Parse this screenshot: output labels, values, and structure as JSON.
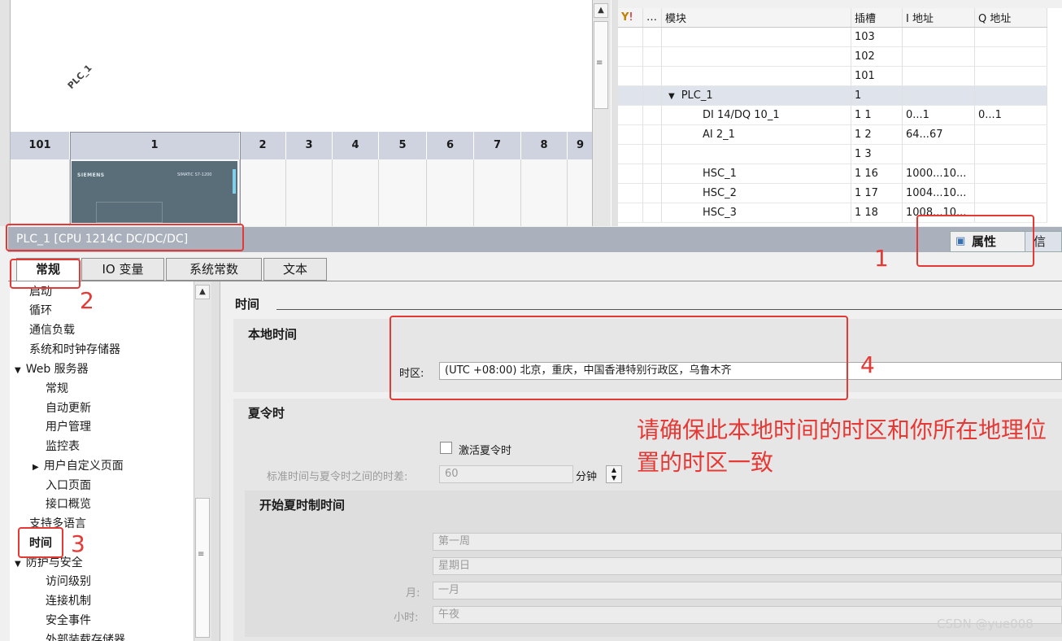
{
  "device_view": {
    "plc_label": "PLC_1",
    "slots": [
      "101",
      "1",
      "2",
      "3",
      "4",
      "5",
      "6",
      "7",
      "8",
      "9"
    ],
    "siemens_text": "SIEMENS",
    "simatic_text": "SIMATIC S7-1200"
  },
  "module_table": {
    "headers": [
      "模块",
      "插槽",
      "I 地址",
      "Q 地址"
    ],
    "rows": [
      {
        "module": "",
        "slot": "103",
        "i": "",
        "q": ""
      },
      {
        "module": "",
        "slot": "102",
        "i": "",
        "q": ""
      },
      {
        "module": "",
        "slot": "101",
        "i": "",
        "q": ""
      },
      {
        "module": "PLC_1",
        "slot": "1",
        "i": "",
        "q": ""
      },
      {
        "module": "DI 14/DQ 10_1",
        "slot": "1 1",
        "i": "0...1",
        "q": "0...1"
      },
      {
        "module": "AI 2_1",
        "slot": "1 2",
        "i": "64...67",
        "q": ""
      },
      {
        "module": "",
        "slot": "1 3",
        "i": "",
        "q": ""
      },
      {
        "module": "HSC_1",
        "slot": "1 16",
        "i": "1000...10...",
        "q": ""
      },
      {
        "module": "HSC_2",
        "slot": "1 17",
        "i": "1004...10...",
        "q": ""
      },
      {
        "module": "HSC_3",
        "slot": "1 18",
        "i": "1008...10...",
        "q": ""
      }
    ]
  },
  "properties": {
    "title": "PLC_1 [CPU 1214C DC/DC/DC]",
    "props_tab": "属性",
    "info_tab": "信",
    "tabs": [
      "常规",
      "IO 变量",
      "系统常数",
      "文本"
    ]
  },
  "nav": {
    "items": [
      {
        "label": "启动",
        "indent": 0
      },
      {
        "label": "循环",
        "indent": 0
      },
      {
        "label": "通信负载",
        "indent": 0
      },
      {
        "label": "系统和时钟存储器",
        "indent": 0
      },
      {
        "label": "Web 服务器",
        "indent": 0,
        "expanded": true
      },
      {
        "label": "常规",
        "indent": 1
      },
      {
        "label": "自动更新",
        "indent": 1
      },
      {
        "label": "用户管理",
        "indent": 1
      },
      {
        "label": "监控表",
        "indent": 1
      },
      {
        "label": "用户自定义页面",
        "indent": 1,
        "collapsed": true
      },
      {
        "label": "入口页面",
        "indent": 1
      },
      {
        "label": "接口概览",
        "indent": 1
      },
      {
        "label": "支持多语言",
        "indent": 0
      },
      {
        "label": "时间",
        "indent": 0,
        "selected": true
      },
      {
        "label": "防护与安全",
        "indent": 0,
        "expanded": true
      },
      {
        "label": "访问级别",
        "indent": 1
      },
      {
        "label": "连接机制",
        "indent": 1
      },
      {
        "label": "安全事件",
        "indent": 1
      },
      {
        "label": "外部装载存储器",
        "indent": 1
      }
    ]
  },
  "content": {
    "section_title": "时间",
    "local_time_title": "本地时间",
    "timezone_label": "时区:",
    "timezone_value": "(UTC +08:00) 北京，重庆，中国香港特别行政区，乌鲁木齐",
    "dst_title": "夏令时",
    "dst_checkbox_label": "激活夏令时",
    "dst_diff_label": "标准时间与夏令时之间的时差:",
    "dst_diff_value": "60",
    "dst_diff_unit": "分钟",
    "start_title": "开始夏时制时间",
    "week_value": "第一周",
    "weekday_value": "星期日",
    "month_label": "月:",
    "month_value": "一月",
    "hour_label": "小时:",
    "hour_value": "午夜"
  },
  "annotations": {
    "num1": "1",
    "num2": "2",
    "num3": "3",
    "num4": "4",
    "note": "请确保此本地时间的时区和你所在地理位置的时区一致",
    "color": "#e53935"
  },
  "watermark": "CSDN @yue008"
}
